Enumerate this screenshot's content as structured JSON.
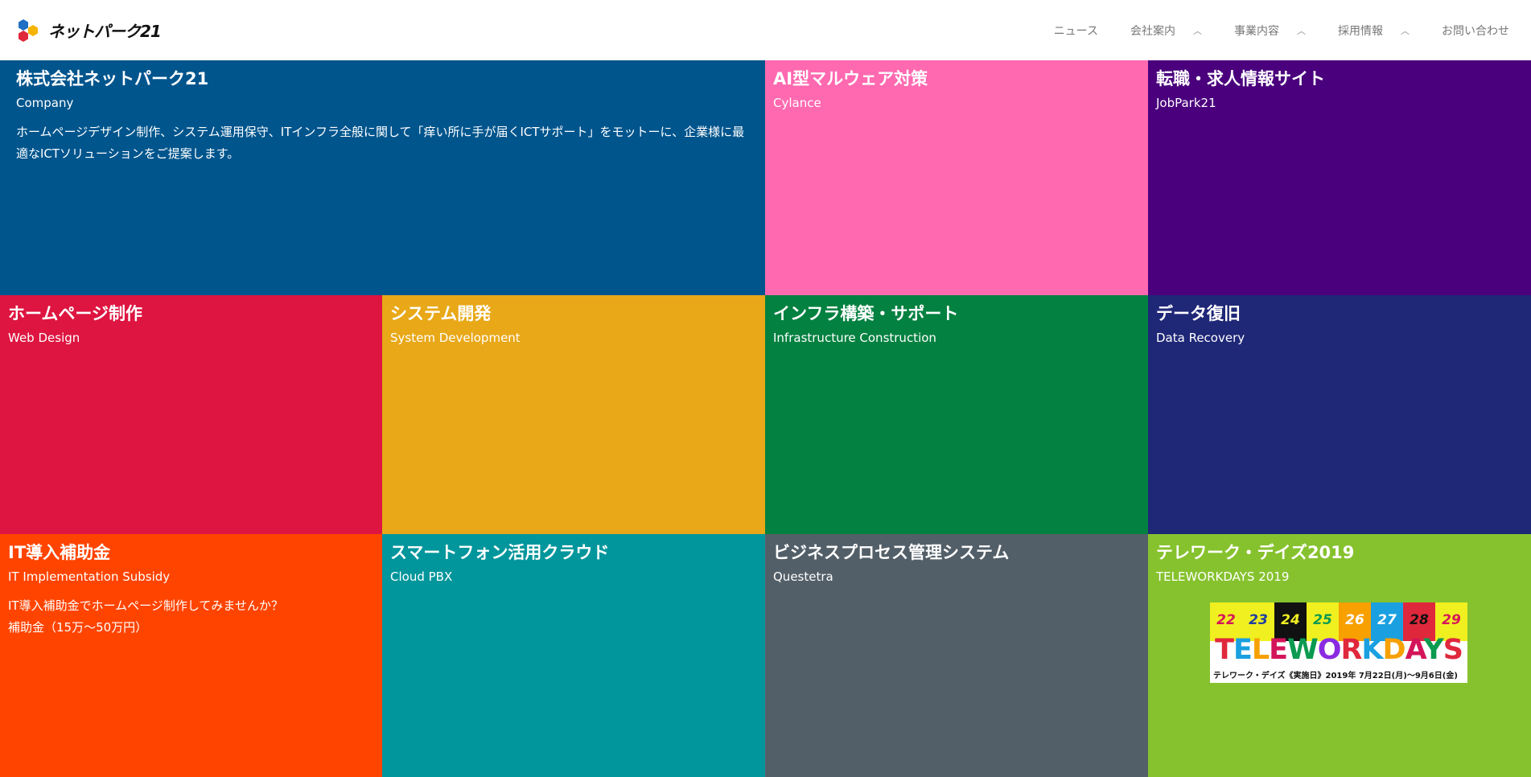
{
  "header": {
    "logo_text": "ネットパーク21",
    "nav": [
      {
        "label": "ニュース",
        "has_dropdown": false
      },
      {
        "label": "会社案内",
        "has_dropdown": true
      },
      {
        "label": "事業内容",
        "has_dropdown": true
      },
      {
        "label": "採用情報",
        "has_dropdown": true
      },
      {
        "label": "お問い合わせ",
        "has_dropdown": false
      }
    ]
  },
  "tiles": {
    "company": {
      "title": "株式会社ネットパーク21",
      "subtitle": "Company",
      "desc": "ホームページデザイン制作、システム運用保守、ITインフラ全般に関して「痒い所に手が届くICTサポート」をモットーに、企業様に最適なICTソリューションをご提案します。",
      "color": "#00558d"
    },
    "cylance": {
      "title": "AI型マルウェア対策",
      "subtitle": "Cylance",
      "color": "#ff69b0"
    },
    "jobpark": {
      "title": "転職・求人情報サイト",
      "subtitle": "JobPark21",
      "color": "#4a007d"
    },
    "webdesign": {
      "title": "ホームページ制作",
      "subtitle": "Web Design",
      "color": "#dd1540"
    },
    "system": {
      "title": "システム開発",
      "subtitle": "System Development",
      "color": "#e8a818"
    },
    "infra": {
      "title": "インフラ構築・サポート",
      "subtitle": "Infrastructure Construction",
      "color": "#038140"
    },
    "recovery": {
      "title": "データ復旧",
      "subtitle": "Data Recovery",
      "color": "#1f2777"
    },
    "subsidy": {
      "title": "IT導入補助金",
      "subtitle": "IT Implementation Subsidy",
      "desc_line1": "IT導入補助金でホームページ制作してみませんか？",
      "desc_line2": "補助金（15万〜50万円）",
      "color": "#ff4400"
    },
    "cloudpbx": {
      "title": "スマートフォン活用クラウド",
      "subtitle": "Cloud PBX",
      "color": "#00969c"
    },
    "questetra": {
      "title": "ビジネスプロセス管理システム",
      "subtitle": "Questetra",
      "color": "#535f68"
    },
    "telework": {
      "title": "テレワーク・デイズ2019",
      "subtitle": "TELEWORKDAYS 2019",
      "color": "#86c22e",
      "banner": {
        "days": [
          "22",
          "23",
          "24",
          "25",
          "26",
          "27",
          "28",
          "29"
        ],
        "word": "TELEWORKDAYS",
        "caption": "テレワーク・デイズ《実施日》2019年 7月22日(月)〜9月6日(金)"
      }
    }
  }
}
